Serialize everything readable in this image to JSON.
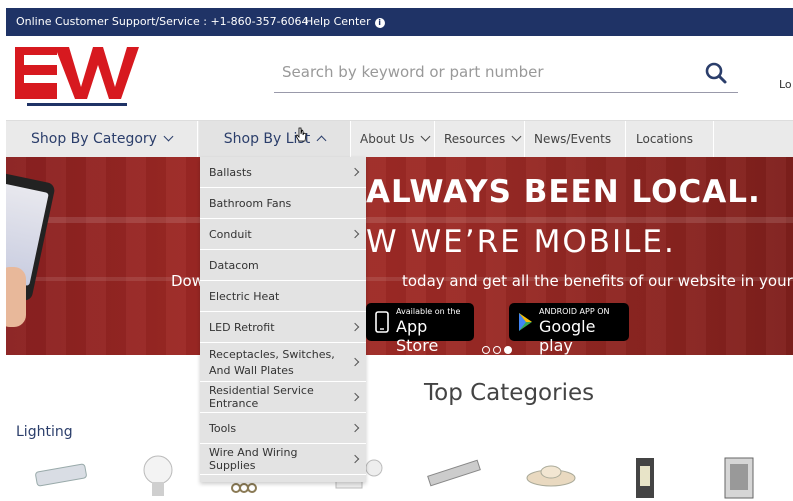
{
  "topbar": {
    "support": "Online Customer Support/Service : +1-860-357-6064",
    "help": "Help Center"
  },
  "logo": {
    "text": "EW"
  },
  "search": {
    "placeholder": "Search by keyword or part number"
  },
  "login": {
    "label": "Lo"
  },
  "nav": {
    "shop_by_category": "Shop By Category",
    "shop_by_list": "Shop By List",
    "items": [
      {
        "label": "About Us"
      },
      {
        "label": "Resources"
      },
      {
        "label": "News/Events"
      },
      {
        "label": "Locations"
      }
    ]
  },
  "banner": {
    "headline1": "ALWAYS BEEN LOCAL.",
    "headline2": "W WE’RE MOBILE.",
    "subtitle_left": "Dow",
    "subtitle_right": "today and get all the benefits of our website in your p",
    "apple_small": "Available on the",
    "apple_big": "App Store",
    "google_small": "ANDROID APP ON",
    "google_big": "Google play",
    "slides": 3,
    "active_slide": 3
  },
  "dropdown": {
    "items": [
      {
        "label": "Ballasts",
        "has_sub": true
      },
      {
        "label": "Bathroom Fans",
        "has_sub": false
      },
      {
        "label": "Conduit",
        "has_sub": true
      },
      {
        "label": "Datacom",
        "has_sub": false
      },
      {
        "label": "Electric Heat",
        "has_sub": false
      },
      {
        "label": "LED Retrofit",
        "has_sub": true
      },
      {
        "label": "Receptacles, Switches, And Wall Plates",
        "has_sub": true
      },
      {
        "label": "Residential Service Entrance",
        "has_sub": true
      },
      {
        "label": "Tools",
        "has_sub": true
      },
      {
        "label": "Wire And Wiring Supplies",
        "has_sub": true
      }
    ]
  },
  "main": {
    "top_categories": "Top Categories",
    "lighting": "Lighting"
  },
  "colors": {
    "topbar": "#1f3366",
    "logo_red": "#d7191f",
    "nav_text": "#2b3e6b",
    "banner_red": "#9b2a25"
  }
}
